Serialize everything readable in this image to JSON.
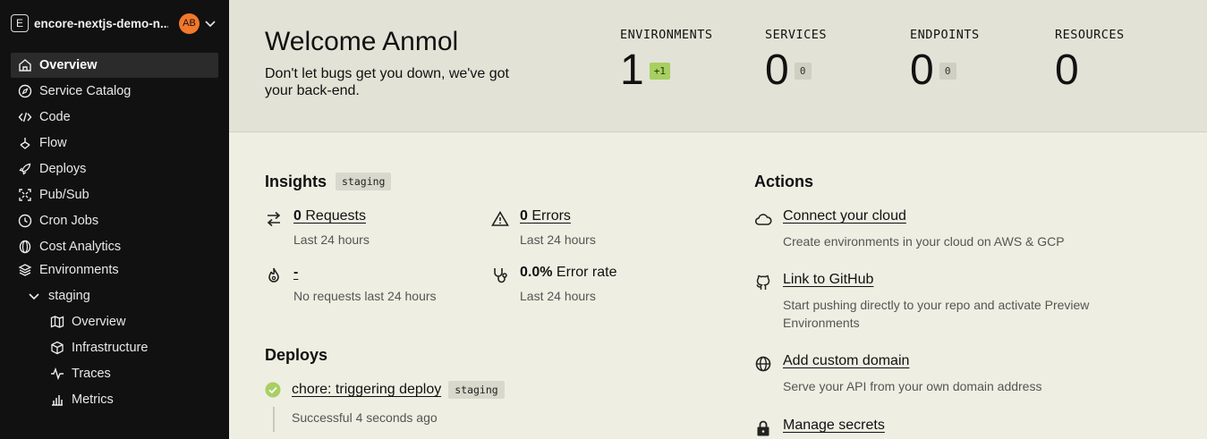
{
  "sidebar": {
    "app_logo_letter": "E",
    "app_name": "encore-nextjs-demo-n...",
    "avatar_initials": "AB",
    "nav": [
      {
        "label": "Overview",
        "icon": "home-icon"
      },
      {
        "label": "Service Catalog",
        "icon": "compass-icon"
      },
      {
        "label": "Code",
        "icon": "code-icon"
      },
      {
        "label": "Flow",
        "icon": "flow-icon"
      },
      {
        "label": "Deploys",
        "icon": "rocket-icon"
      },
      {
        "label": "Pub/Sub",
        "icon": "pubsub-icon"
      },
      {
        "label": "Cron Jobs",
        "icon": "clock-icon"
      },
      {
        "label": "Cost Analytics",
        "icon": "coin-icon"
      },
      {
        "label": "Environments",
        "icon": "layers-icon"
      }
    ],
    "env_name": "staging",
    "env_nav": [
      {
        "label": "Overview",
        "icon": "map-icon"
      },
      {
        "label": "Infrastructure",
        "icon": "box-icon"
      },
      {
        "label": "Traces",
        "icon": "pulse-icon"
      },
      {
        "label": "Metrics",
        "icon": "bar-chart-icon"
      }
    ]
  },
  "header": {
    "welcome": "Welcome Anmol",
    "tagline": "Don't let bugs get you down, we've got your back-end."
  },
  "stats": [
    {
      "label": "ENVIRONMENTS",
      "value": "1",
      "badge": "+1"
    },
    {
      "label": "SERVICES",
      "value": "0",
      "badge": "0"
    },
    {
      "label": "ENDPOINTS",
      "value": "0",
      "badge": "0"
    },
    {
      "label": "RESOURCES",
      "value": "0"
    }
  ],
  "insights": {
    "title": "Insights",
    "env_tag": "staging",
    "requests": {
      "count": "0",
      "label": "Requests",
      "sub": "Last 24 hours"
    },
    "errors": {
      "count": "0",
      "label": "Errors",
      "sub": "Last 24 hours"
    },
    "latency": {
      "value": "-",
      "sub": "No requests last 24 hours"
    },
    "error_rate": {
      "value": "0.0%",
      "label": "Error rate",
      "sub": "Last 24 hours"
    }
  },
  "deploys": {
    "title": "Deploys",
    "items": [
      {
        "title": "chore: triggering deploy",
        "env": "staging",
        "status": "Successful 4 seconds ago"
      }
    ]
  },
  "actions": {
    "title": "Actions",
    "items": [
      {
        "title": "Connect your cloud",
        "sub": "Create environments in your cloud on AWS & GCP",
        "icon": "cloud-icon"
      },
      {
        "title": "Link to GitHub",
        "sub": "Start pushing directly to your repo and activate Preview Environments",
        "icon": "github-icon"
      },
      {
        "title": "Add custom domain",
        "sub": "Serve your API from your own domain address",
        "icon": "globe-icon"
      },
      {
        "title": "Manage secrets",
        "sub": "",
        "icon": "lock-icon"
      }
    ]
  },
  "colors": {
    "sidebar_bg": "#111111",
    "header_bg": "#e2e2d6",
    "content_bg": "#eeeee2",
    "avatar": "#f2782b",
    "success": "#a8cf62"
  }
}
